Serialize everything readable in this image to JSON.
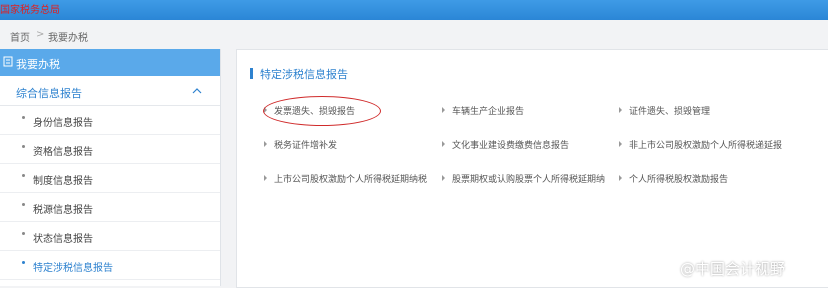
{
  "header": {
    "logo_text": "国家税务总局",
    "accent": "#2b86d6"
  },
  "breadcrumb": {
    "home": "首页",
    "sep": ">",
    "current": "我要办税"
  },
  "sidebar": {
    "title": "我要办税",
    "section": "综合信息报告",
    "items": [
      {
        "label": "身份信息报告"
      },
      {
        "label": "资格信息报告"
      },
      {
        "label": "制度信息报告"
      },
      {
        "label": "税源信息报告"
      },
      {
        "label": "状态信息报告"
      },
      {
        "label": "特定涉税信息报告"
      }
    ]
  },
  "main": {
    "title": "特定涉税信息报告",
    "links": [
      {
        "label": "发票遗失、损毁报告"
      },
      {
        "label": "车辆生产企业报告"
      },
      {
        "label": "证件遗失、损毁管理"
      },
      {
        "label": "税务证件增补发"
      },
      {
        "label": "文化事业建设费缴费信息报告"
      },
      {
        "label": "非上市公司股权激励个人所得税递延报"
      },
      {
        "label": "上市公司股权激励个人所得税延期纳税"
      },
      {
        "label": "股票期权或认购股票个人所得税延期纳"
      },
      {
        "label": "个人所得税股权激励报告"
      }
    ],
    "highlight_color": "#d02b2b"
  },
  "watermark": {
    "text": "@中国会计视野"
  }
}
